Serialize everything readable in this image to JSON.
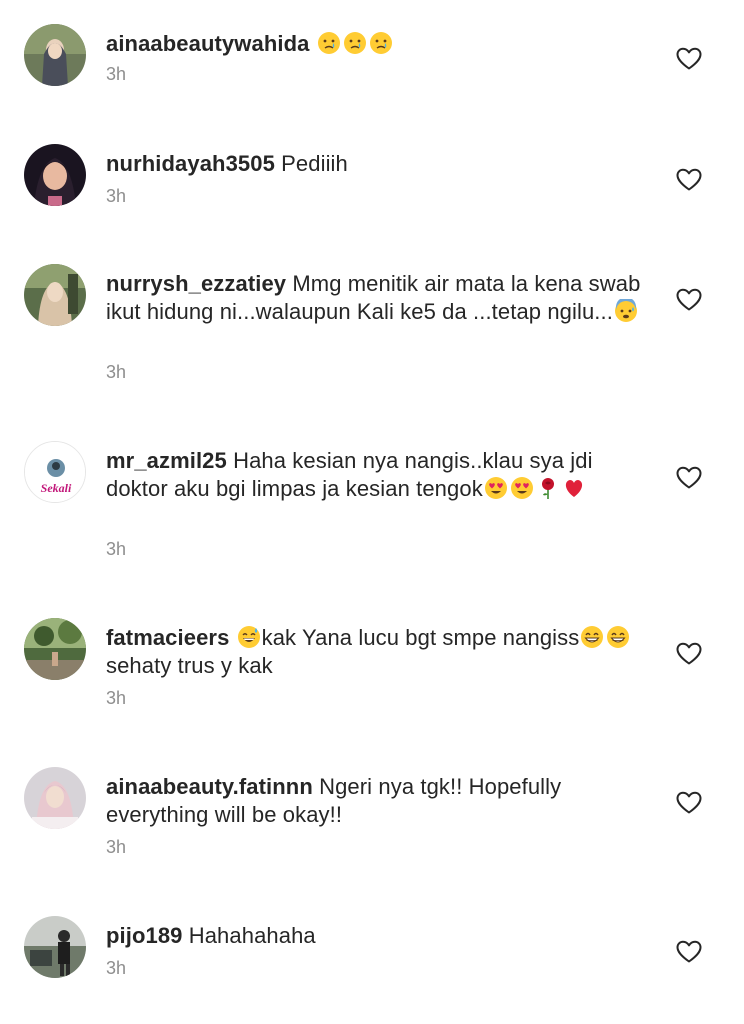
{
  "comments": [
    {
      "username": "ainaabeautywahida",
      "segments": [
        {
          "type": "emoji",
          "name": "crying-face"
        },
        {
          "type": "emoji",
          "name": "crying-face"
        },
        {
          "type": "emoji",
          "name": "crying-face"
        }
      ],
      "time": "3h"
    },
    {
      "username": "nurhidayah3505",
      "segments": [
        {
          "type": "text",
          "value": "Pediiih"
        }
      ],
      "time": "3h"
    },
    {
      "username": "nurrysh_ezzatiey",
      "segments": [
        {
          "type": "text",
          "value": "Mmg menitik air mata la kena swab ikut hidung ni...walaupun Kali ke5 da ...tetap ngilu..."
        },
        {
          "type": "emoji",
          "name": "anxious-face-with-sweat"
        }
      ],
      "time": "3h"
    },
    {
      "username": "mr_azmil25",
      "segments": [
        {
          "type": "text",
          "value": "Haha kesian nya nangis..klau sya jdi doktor aku bgi limpas ja kesian tengok"
        },
        {
          "type": "emoji",
          "name": "heart-eyes-face"
        },
        {
          "type": "emoji",
          "name": "heart-eyes-face"
        },
        {
          "type": "emoji",
          "name": "rose"
        },
        {
          "type": "emoji",
          "name": "red-heart"
        }
      ],
      "avatar_text": "Sekali",
      "time": "3h"
    },
    {
      "username": "fatmacieers",
      "segments": [
        {
          "type": "emoji",
          "name": "grinning-face-with-sweat"
        },
        {
          "type": "text",
          "value": "kak Yana lucu bgt smpe nangiss"
        },
        {
          "type": "emoji",
          "name": "beaming-face"
        },
        {
          "type": "emoji",
          "name": "beaming-face"
        },
        {
          "type": "text",
          "value": " sehaty trus y kak"
        }
      ],
      "time": "3h"
    },
    {
      "username": "ainaabeauty.fatinnn",
      "segments": [
        {
          "type": "text",
          "value": "Ngeri nya tgk!! Hopefully everything will be okay!!"
        }
      ],
      "time": "3h"
    },
    {
      "username": "pijo189",
      "segments": [
        {
          "type": "text",
          "value": "Hahahahaha"
        }
      ],
      "time": "3h"
    }
  ],
  "colors": {
    "text": "#262626",
    "muted": "#8e8e8e",
    "heart_outline": "#262626"
  },
  "icons": {
    "like": "heart-outline-icon"
  }
}
